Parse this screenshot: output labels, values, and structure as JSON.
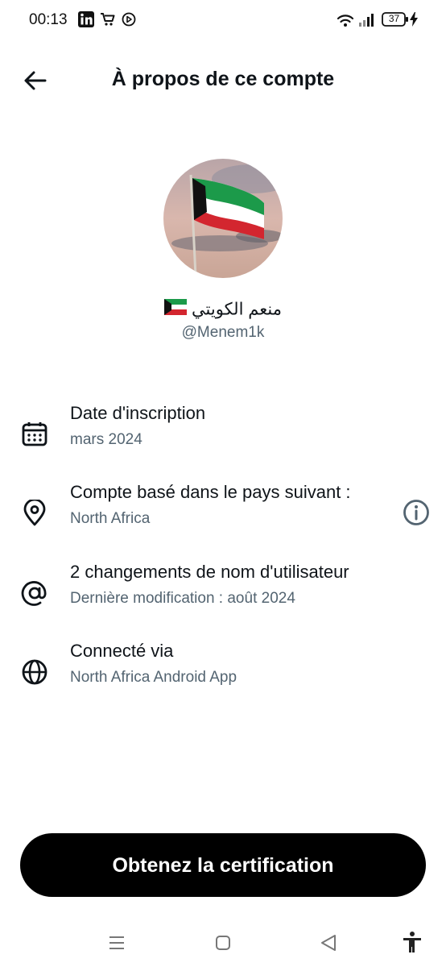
{
  "status_bar": {
    "time": "00:13",
    "battery": "37",
    "icons": [
      "linkedin-icon",
      "cart-icon",
      "play-icon",
      "wifi-icon",
      "signal-icon",
      "battery-icon",
      "charging-icon"
    ]
  },
  "header": {
    "title": "À propos de ce compte",
    "back_icon": "arrow-left-icon"
  },
  "profile": {
    "display_name": "منعم الكويتي",
    "flag_emoji": "🇰🇼",
    "handle": "@Menem1k"
  },
  "details": [
    {
      "icon": "calendar-icon",
      "title": "Date d'inscription",
      "subtitle": "mars 2024"
    },
    {
      "icon": "location-pin-icon",
      "title": "Compte basé dans le pays suivant :",
      "subtitle": "North Africa",
      "trailing_icon": "info-icon"
    },
    {
      "icon": "at-sign-icon",
      "title": "2 changements de nom d'utilisateur",
      "subtitle": "Dernière modification : août 2024"
    },
    {
      "icon": "globe-icon",
      "title": "Connecté via",
      "subtitle": "North Africa Android App"
    }
  ],
  "cta": {
    "label": "Obtenez la certification"
  },
  "nav_bar": {
    "icons": [
      "menu-icon",
      "home-square-icon",
      "back-triangle-icon",
      "accessibility-icon"
    ]
  },
  "colors": {
    "primary_text": "#0f1419",
    "secondary_text": "#536471",
    "cta_background": "#000000",
    "cta_text": "#ffffff"
  }
}
